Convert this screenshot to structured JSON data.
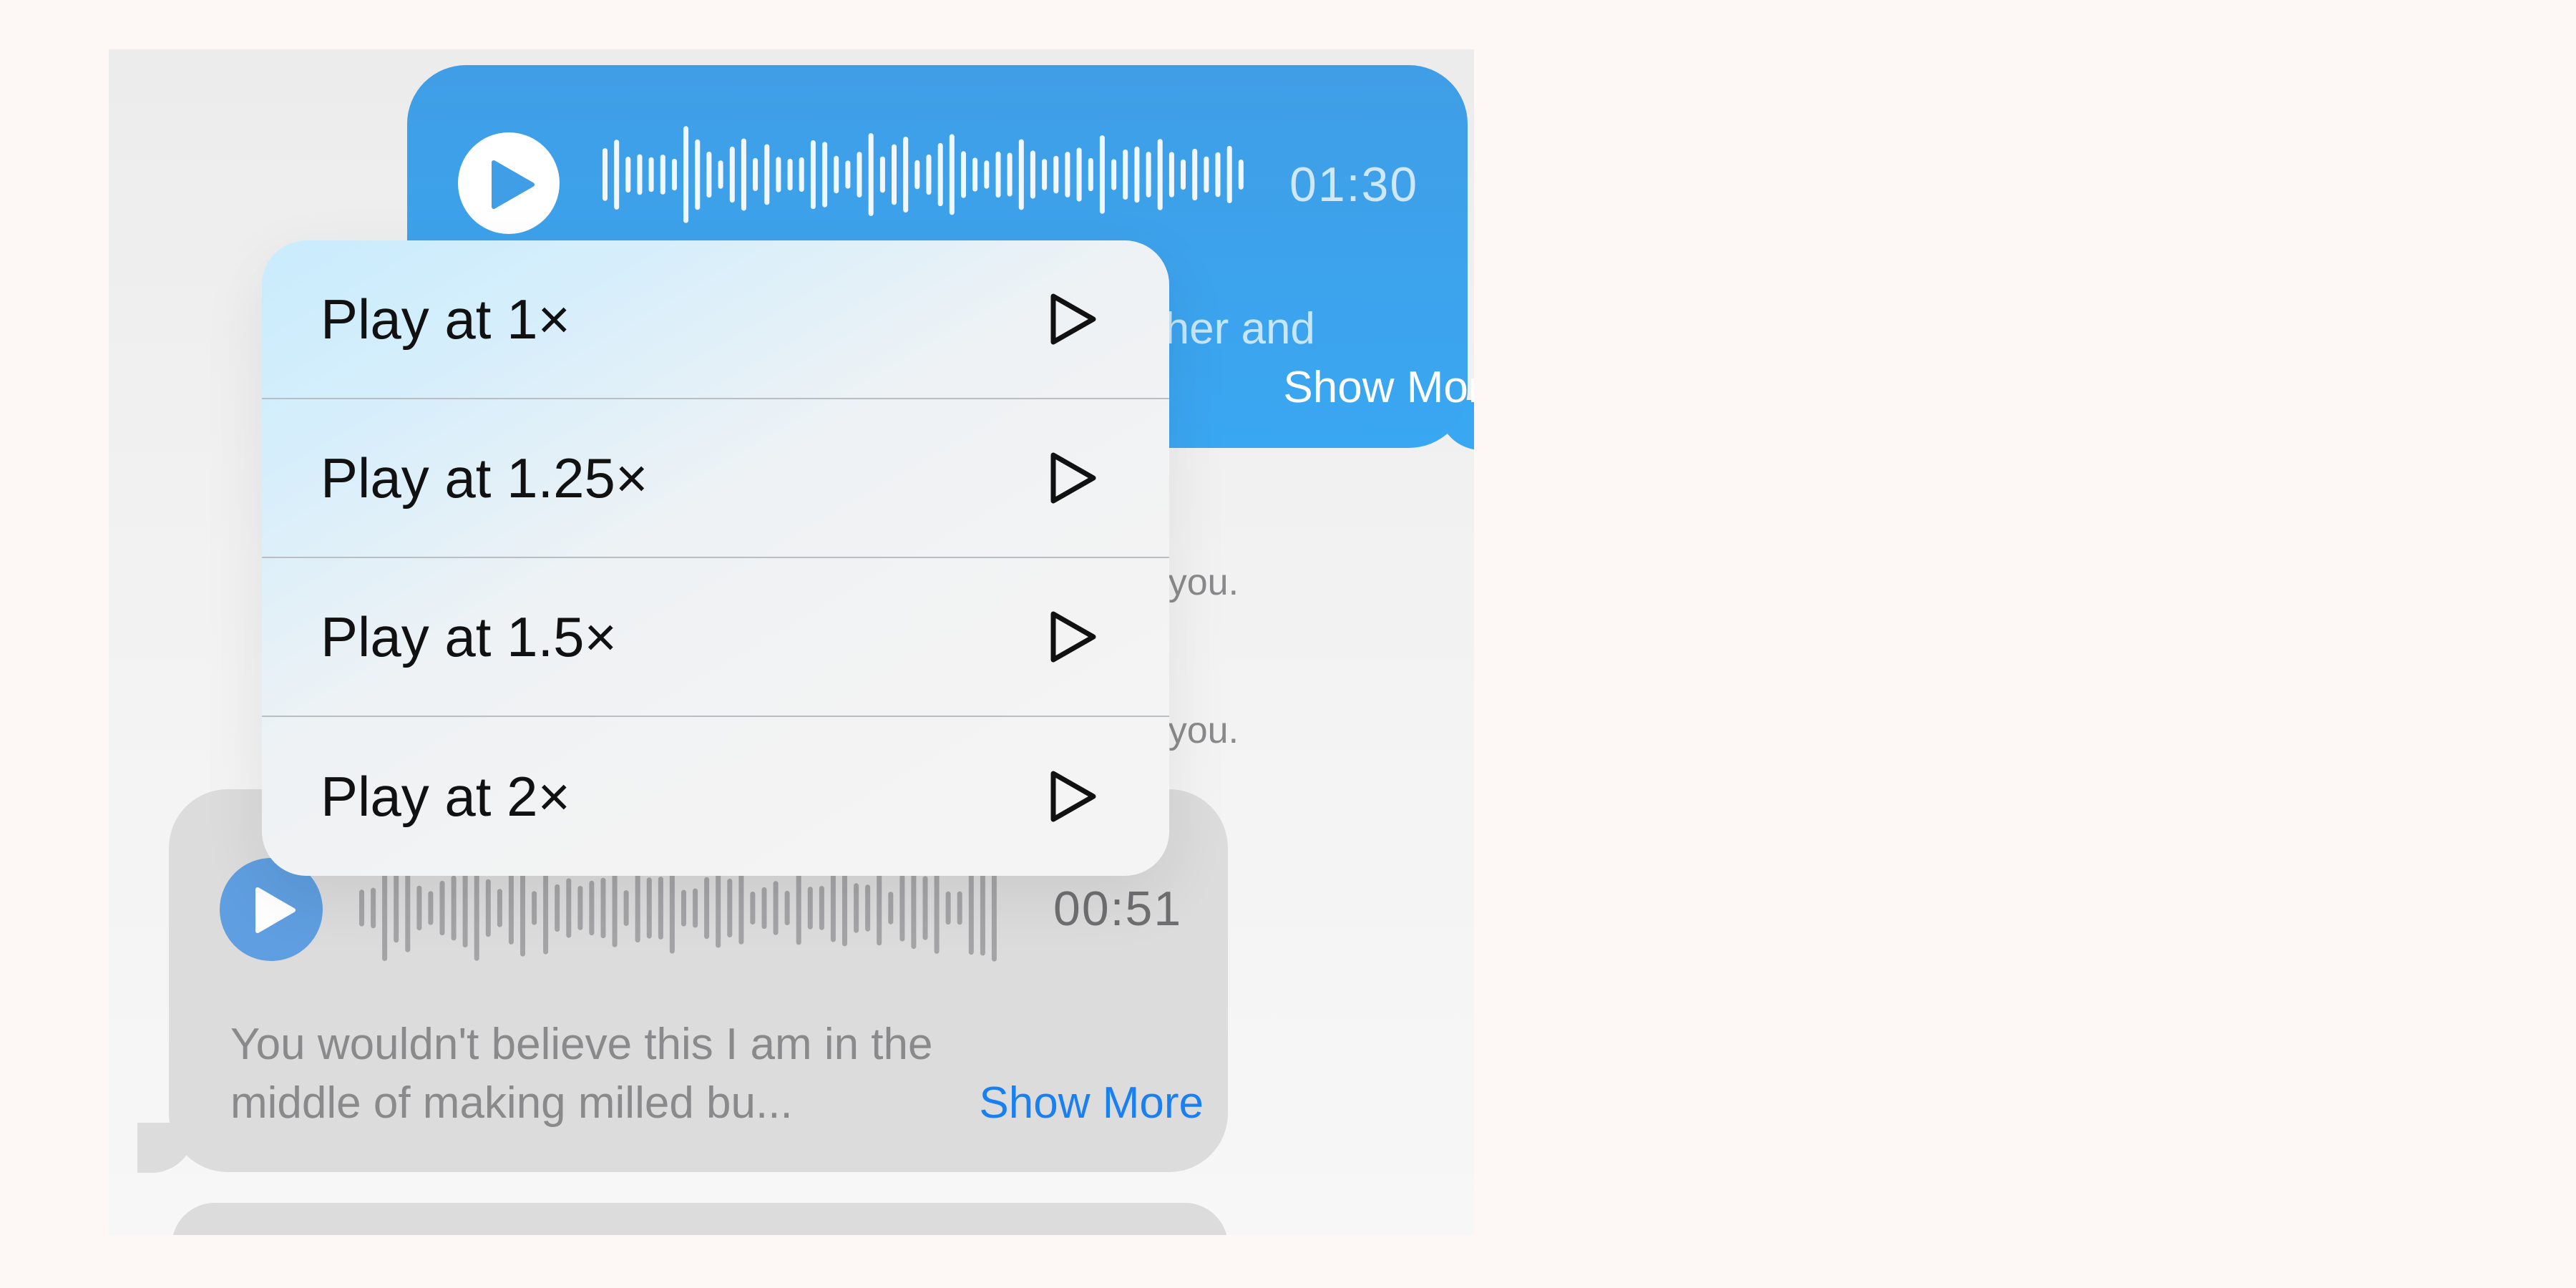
{
  "outgoing_message": {
    "duration": "01:30",
    "transcript_fragment": "ding on her and",
    "transcript_ellipsis": "...",
    "show_more": "Show More",
    "bubble_color": "#3aa7f2",
    "play_icon": "play-icon"
  },
  "status_lines": [
    "ge from you.",
    "ge from you."
  ],
  "incoming_message": {
    "duration": "00:51",
    "transcript_line1": "You wouldn't believe this I am in the",
    "transcript_line2": "middle of making milled bu...",
    "show_more": "Show More",
    "play_color": "#5f9ee0",
    "link_color": "#1a7ff0",
    "play_icon": "play-icon"
  },
  "playback_menu": {
    "items": [
      {
        "label": "Play at 1×",
        "icon": "play-outline-icon"
      },
      {
        "label": "Play at 1.25×",
        "icon": "play-outline-icon"
      },
      {
        "label": "Play at 1.5×",
        "icon": "play-outline-icon"
      },
      {
        "label": "Play at 2×",
        "icon": "play-outline-icon"
      }
    ]
  }
}
